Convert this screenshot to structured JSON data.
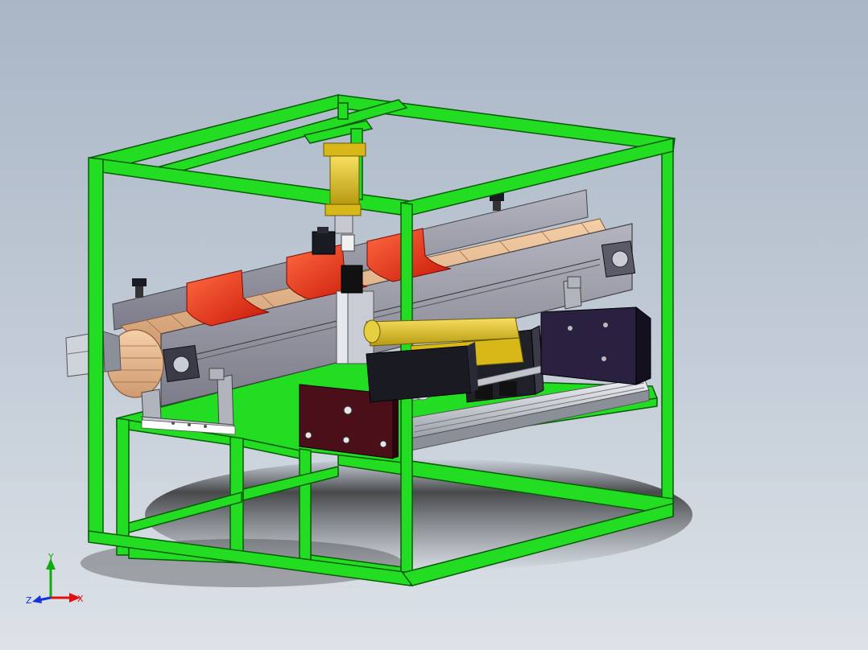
{
  "viewport": {
    "background_top": "#a9b6c6",
    "background_bottom": "#dde2e8"
  },
  "model": {
    "frame_color": "#22dd22",
    "frame_edge_color": "#0a5a0a",
    "conveyor_color": "#9a9aa8",
    "chain_color": "#e6b894",
    "holder_color": "#e02010",
    "cylinder_color": "#e0c020",
    "mount_plate_color": "#4a0f18",
    "motor_color": "#2a2040",
    "rail_color": "#c8ccd4"
  },
  "triad": {
    "x_label": "X",
    "y_label": "Y",
    "z_label": "Z",
    "x_color": "#dd1111",
    "y_color": "#11aa11",
    "z_color": "#1133dd"
  }
}
